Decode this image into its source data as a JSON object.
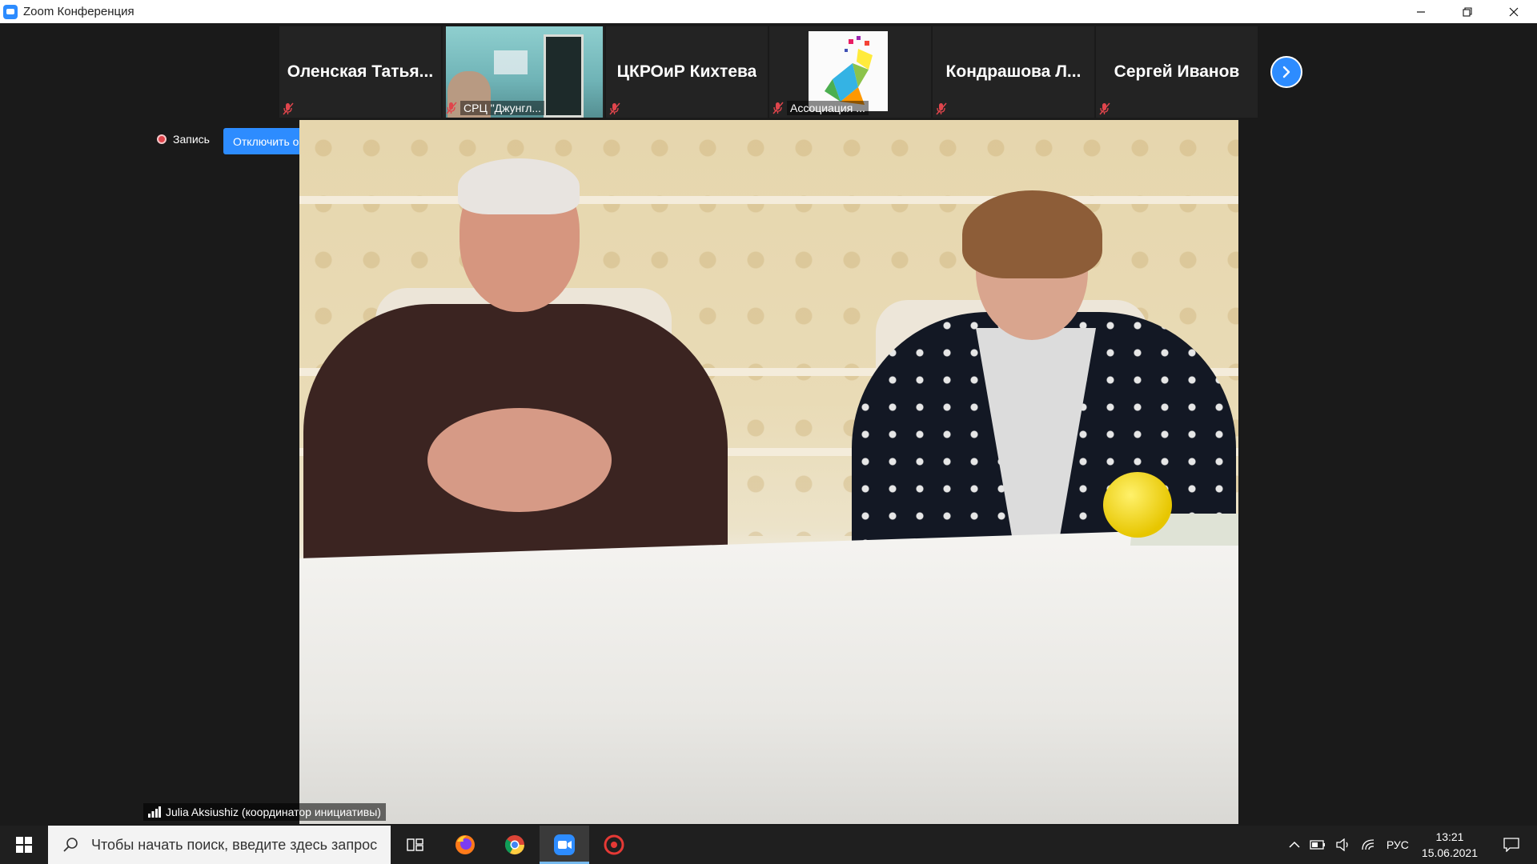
{
  "window": {
    "title": "Zoom Конференция",
    "colors": {
      "accent": "#2D8CFF",
      "muted_mic": "#e0454c"
    }
  },
  "gallery": {
    "tiles": [
      {
        "name": "Оленская  Татья...",
        "type": "name",
        "mic": "muted"
      },
      {
        "name": "СРЦ \"Джунгл...",
        "type": "video",
        "mic": "muted"
      },
      {
        "name": "ЦКРОиР Кихтева",
        "type": "name",
        "mic": "muted"
      },
      {
        "name": "Ассоциация ...",
        "type": "logo",
        "mic": "muted"
      },
      {
        "name": "Кондрашова  Л...",
        "type": "name",
        "mic": "muted"
      },
      {
        "name": "Сергей Иванов",
        "type": "name",
        "mic": "muted"
      }
    ],
    "next_icon": "chevron-right-icon"
  },
  "recording": {
    "label": "Запись"
  },
  "original_sound": {
    "label": "Отключить оригинальный звук"
  },
  "active_speaker": {
    "name": "Julia Aksiushiz (координатор инициативы)"
  },
  "taskbar": {
    "search_placeholder": "Чтобы начать поиск, введите здесь запрос",
    "apps": [
      "task-view-icon",
      "firefox-icon",
      "chrome-icon",
      "zoom-icon",
      "app-red-icon"
    ],
    "language": "РУС",
    "time": "13:21",
    "date": "15.06.2021"
  }
}
